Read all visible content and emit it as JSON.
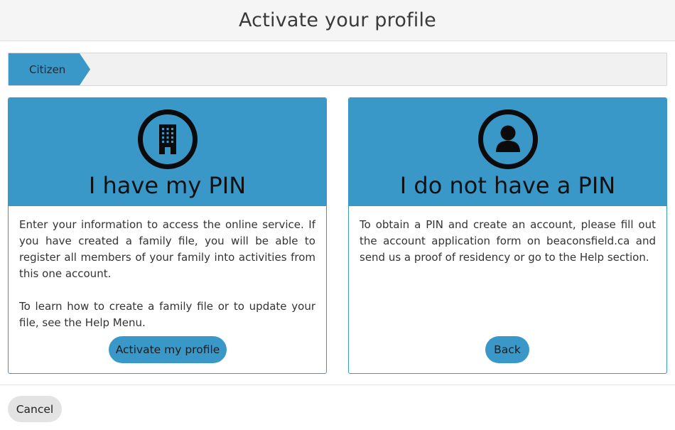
{
  "header": {
    "title": "Activate your profile"
  },
  "breadcrumb": {
    "items": [
      "Citizen"
    ]
  },
  "cards": {
    "pin": {
      "title": "I have my PIN",
      "icon": "building-icon",
      "paragraphs": [
        "Enter your information to access the online service. If you have created a family file, you will be able to register all members of your family into activities from this one account.",
        "To learn how to create a family file or to update your file, see the Help Menu."
      ],
      "button_label": "Activate my profile"
    },
    "nopin": {
      "title": "I do not have a PIN",
      "icon": "user-icon",
      "paragraphs": [
        "To obtain a PIN and create an account, please fill out the account application form on beaconsfield.ca and send us a proof of residency or go to the Help section."
      ],
      "button_label": "Back"
    }
  },
  "footer": {
    "cancel_label": "Cancel"
  },
  "colors": {
    "accent": "#3a98c9",
    "header_bg": "#f5f5f5",
    "cancel_bg": "#e3e3e3"
  }
}
